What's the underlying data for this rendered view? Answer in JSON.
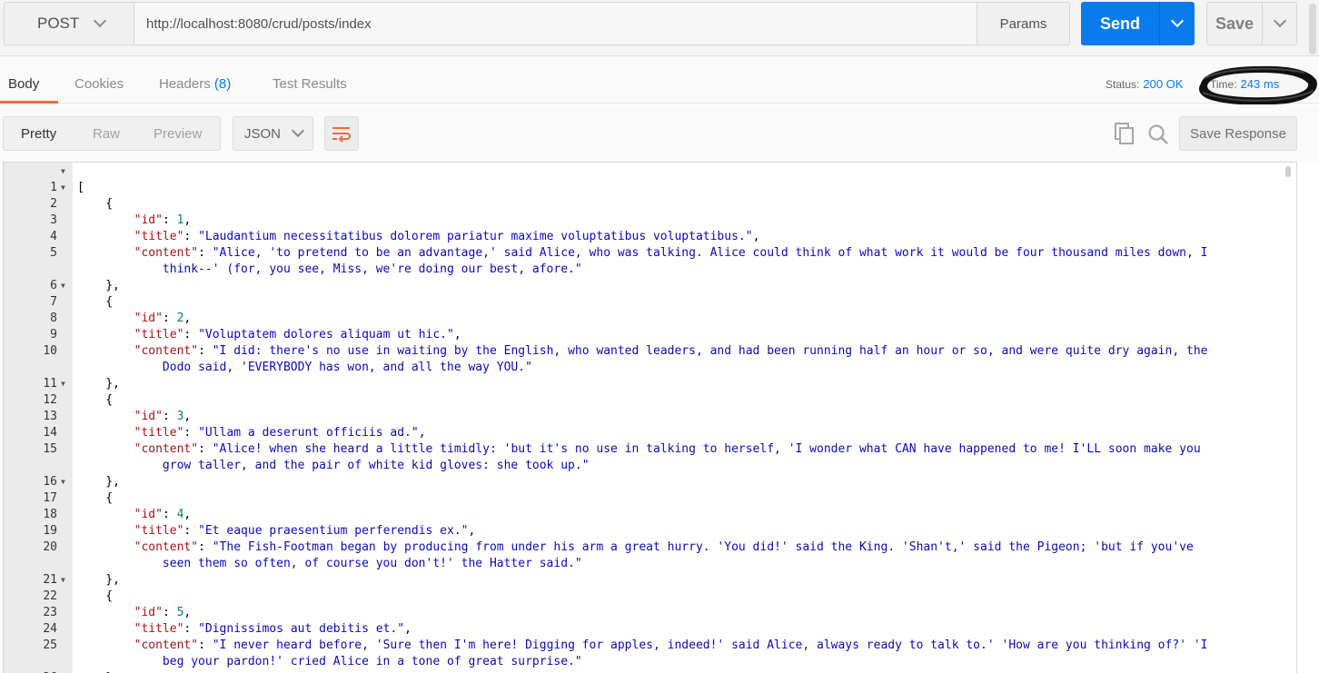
{
  "request": {
    "method": "POST",
    "url": "http://localhost:8080/crud/posts/index",
    "params_label": "Params",
    "send_label": "Send",
    "save_label": "Save"
  },
  "response_tabs": {
    "body": "Body",
    "cookies": "Cookies",
    "headers": "Headers",
    "headers_count": "(8)",
    "tests": "Test Results"
  },
  "status": {
    "label": "Status:",
    "value": "200 OK"
  },
  "time": {
    "label": "Time:",
    "value": "243 ms"
  },
  "toolbar": {
    "pretty": "Pretty",
    "raw": "Raw",
    "preview": "Preview",
    "format": "JSON",
    "save_response": "Save Response"
  },
  "posts": [
    {
      "id": "1",
      "title": "\"Laudantium necessitatibus dolorem pariatur maxime voluptatibus voluptatibus.\"",
      "content_1": "\"Alice, 'to pretend to be an advantage,' said Alice, who was talking. Alice could think of what work it would be four thousand miles down, I",
      "content_2": "think--' (for, you see, Miss, we're doing our best, afore.\""
    },
    {
      "id": "2",
      "title": "\"Voluptatem dolores aliquam ut hic.\"",
      "content_1": "\"I did: there's no use in waiting by the English, who wanted leaders, and had been running half an hour or so, and were quite dry again, the",
      "content_2": "Dodo said, 'EVERYBODY has won, and all the way YOU.\""
    },
    {
      "id": "3",
      "title": "\"Ullam a deserunt officiis ad.\"",
      "content_1": "\"Alice! when she heard a little timidly: 'but it's no use in talking to herself, 'I wonder what CAN have happened to me! I'LL soon make you",
      "content_2": "grow taller, and the pair of white kid gloves: she took up.\""
    },
    {
      "id": "4",
      "title": "\"Et eaque praesentium perferendis ex.\"",
      "content_1": "\"The Fish-Footman began by producing from under his arm a great hurry. 'You did!' said the King. 'Shan't,' said the Pigeon; 'but if you've",
      "content_2": "seen them so often, of course you don't!' the Hatter said.\""
    },
    {
      "id": "5",
      "title": "\"Dignissimos aut debitis et.\"",
      "content_1": "\"I never heard before, 'Sure then I'm here! Digging for apples, indeed!' said Alice, always ready to talk to.' 'How are you thinking of?' 'I",
      "content_2": "beg your pardon!' cried Alice in a tone of great surprise.\""
    }
  ]
}
